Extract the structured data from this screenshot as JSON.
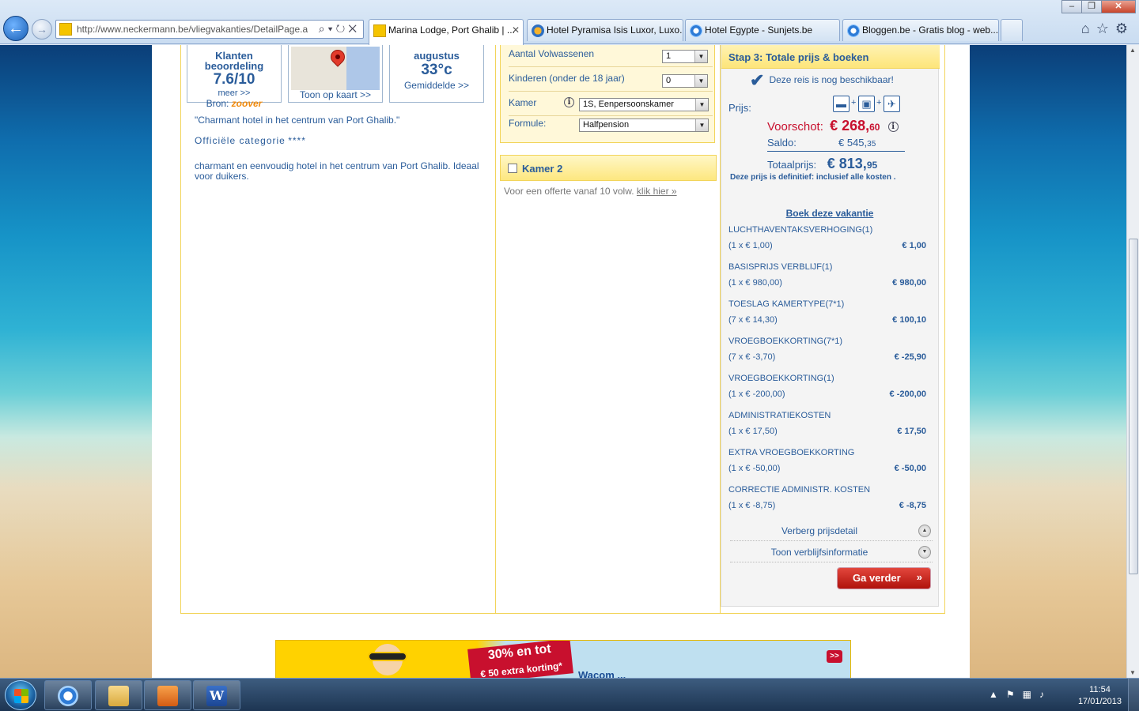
{
  "browser": {
    "address_url": "http://www.neckermann.be/vliegvakanties/DetailPage.a",
    "address_host": "neckermann.be",
    "tabs": [
      {
        "label": "Marina Lodge, Port Ghalib | ...",
        "active": true
      },
      {
        "label": "Hotel Pyramisa Isis Luxor, Luxo..."
      },
      {
        "label": "Hotel Egypte - Sunjets.be"
      },
      {
        "label": "Bloggen.be - Gratis blog - web..."
      }
    ]
  },
  "rating": {
    "label": "Klanten beoordeling",
    "score": "7.6/10",
    "more": "meer >>",
    "source_label": "Bron:",
    "source_name": "zoover"
  },
  "map": {
    "link": "Toon op kaart >>"
  },
  "weather": {
    "month": "augustus",
    "temp": "33°c",
    "avg_label": "Gemiddelde >>"
  },
  "hotel": {
    "quote": "\"Charmant hotel in het centrum van Port Ghalib.\"",
    "category_label": "Officiële categorie",
    "category_stars": "****",
    "description": "charmant en eenvoudig hotel in het centrum van Port Ghalib. Ideaal voor duikers."
  },
  "form": {
    "adults_label": "Aantal Volwassenen",
    "adults_value": "1",
    "children_label": "Kinderen (onder de 18 jaar)",
    "children_value": "0",
    "room_label": "Kamer",
    "room_value": "1S, Eenpersoonskamer",
    "formula_label": "Formule:",
    "formula_value": "Halfpension"
  },
  "room2": {
    "title": "Kamer 2",
    "offer_text": "Voor een offerte vanaf 10 volw.",
    "offer_link": "klik hier »"
  },
  "summary": {
    "step_title": "Stap 3: Totale prijs & boeken",
    "available": "Deze reis is nog beschikbaar!",
    "prijs_label": "Prijs:",
    "voorschot_label": "Voorschot:",
    "voorschot_main": "€ 268,",
    "voorschot_cents": "60",
    "saldo_label": "Saldo:",
    "saldo_main": "€ 545,",
    "saldo_cents": "35",
    "totaal_label": "Totaalprijs:",
    "totaal_main": "€ 813,",
    "totaal_cents": "95",
    "note_pre": "Deze prijs is",
    "note_def": "definitief",
    "note_post": ": inclusief alle kosten .",
    "book_link": "Boek deze vakantie",
    "toggle_detail": "Verberg prijsdetail",
    "toggle_verblijf": "Toon verblijfsinformatie",
    "button": "Ga verder",
    "button_chevron": "»",
    "items": [
      {
        "name": "LUCHTHAVENTAKSVERHOGING(1)",
        "calc": "(1 x € 1,00)",
        "amount": "€ 1,00"
      },
      {
        "name": "BASISPRIJS VERBLIJF(1)",
        "calc": "(1 x € 980,00)",
        "amount": "€ 980,00"
      },
      {
        "name": "TOESLAG KAMERTYPE(7*1)",
        "calc": "(7 x € 14,30)",
        "amount": "€ 100,10"
      },
      {
        "name": "VROEGBOEKKORTING(7*1)",
        "calc": "(7 x € -3,70)",
        "amount": "€ -25,90"
      },
      {
        "name": "VROEGBOEKKORTING(1)",
        "calc": "(1 x € -200,00)",
        "amount": "€ -200,00"
      },
      {
        "name": "ADMINISTRATIEKOSTEN",
        "calc": "(1 x € 17,50)",
        "amount": "€ 17,50"
      },
      {
        "name": "EXTRA VROEGBOEKKORTING",
        "calc": "(1 x € -50,00)",
        "amount": "€ -50,00"
      },
      {
        "name": "CORRECTIE ADMINISTR. KOSTEN",
        "calc": "(1 x € -8,75)",
        "amount": "€ -8,75"
      }
    ]
  },
  "banner": {
    "promo_line1": "30% en tot",
    "promo_line2": "€ 50 extra korting*",
    "tagline": "Wacom ... ",
    "go": ">>"
  },
  "taskbar": {
    "time": "11:54",
    "date": "17/01/2013"
  }
}
